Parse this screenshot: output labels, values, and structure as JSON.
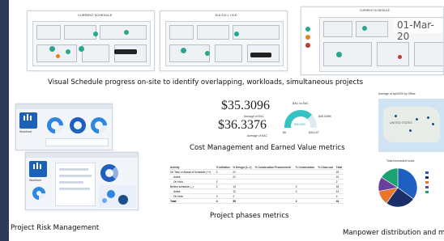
{
  "captions": {
    "schedule": "Visual Schedule progress on-site to identify overlapping, workloads, simultaneous projects",
    "cost": "Cost Management and Earned Value metrics",
    "phases": "Project phases metrics",
    "risk": "Project Risk Management",
    "manpower": "Manpower distribution and m"
  },
  "schedule_panels": {
    "current_title": "CURRENT SCHEDULE",
    "baseline_title": "BASELINE",
    "right_title": "CURRENT SCHEDULE",
    "date": "01-Mar-20"
  },
  "cost": {
    "value1": "$35.3096",
    "value1_label": "Average of EAC",
    "value2": "$36.3376",
    "value2_label": "Average of EAC",
    "gauge_title": "BAC vs EAC",
    "gauge_center": "$36.33%",
    "gauge_min": "$0",
    "gauge_max": "$44.197",
    "gauge_right": "$35.309M"
  },
  "phases_table": {
    "headers": [
      "Activity",
      "% Initiation",
      "% Design (1-->)",
      "% Construction Procurement",
      "% Construction",
      "% Close-out",
      "Total"
    ],
    "rows": [
      [
        "On Time or Ahead of Schedule (++)",
        "2",
        "21",
        "",
        "",
        "",
        "23"
      ],
      [
        "Active",
        "",
        "21",
        "",
        "",
        "",
        "21"
      ],
      [
        "On Hold",
        "2",
        "",
        "",
        "",
        "",
        "2"
      ],
      [
        "Behind schedule (--)",
        "2",
        "14",
        "",
        "2",
        "",
        "18"
      ],
      [
        "Active",
        "",
        "12",
        "",
        "2",
        "",
        "14"
      ],
      [
        "On Hold",
        "2",
        "2",
        "",
        "",
        "",
        "4"
      ],
      [
        "Total",
        "4",
        "35",
        "",
        "2",
        "",
        "41"
      ]
    ]
  },
  "map": {
    "title": "Average of Apr2020 by Office",
    "country": "UNITED STATES"
  },
  "pie": {
    "title": "Total forecasted hours",
    "slices": [
      {
        "label": "Blue",
        "value": 35,
        "color": "#1f5fbf"
      },
      {
        "label": "Navy",
        "value": 25,
        "color": "#1b2f6b"
      },
      {
        "label": "Orange",
        "value": 12,
        "color": "#e8772e"
      },
      {
        "label": "Purple",
        "value": 12,
        "color": "#6b3fa0"
      },
      {
        "label": "Green",
        "value": 16,
        "color": "#1aa36f"
      }
    ]
  },
  "risk": {
    "app1": "Workfront",
    "app2": "Workfront"
  }
}
